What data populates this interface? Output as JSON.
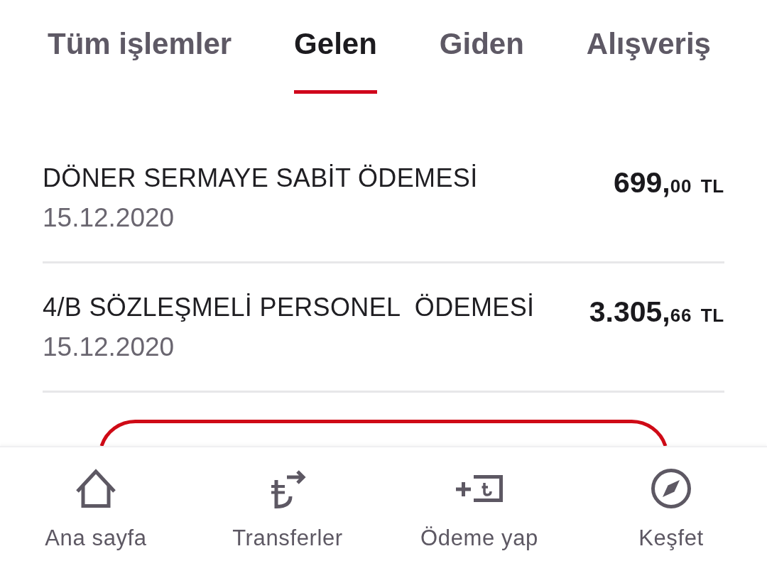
{
  "tabs": [
    {
      "label": "Tüm işlemler",
      "selected": false
    },
    {
      "label": "Gelen",
      "selected": true
    },
    {
      "label": "Giden",
      "selected": false
    },
    {
      "label": "Alışveriş",
      "selected": false
    }
  ],
  "transactions": [
    {
      "title": "DÖNER SERMAYE SABİT ÖDEMESİ",
      "date": "15.12.2020",
      "amount": {
        "whole": "699,",
        "fraction": "00",
        "currency": "TL"
      }
    },
    {
      "title": "4/B SÖZLEŞMELİ PERSONEL  ÖDEMESİ",
      "date": "15.12.2020",
      "amount": {
        "whole": "3.305,",
        "fraction": "66",
        "currency": "TL"
      }
    }
  ],
  "bottom_nav": [
    {
      "label": "Ana sayfa",
      "selected": false
    },
    {
      "label": "Transferler",
      "selected": false
    },
    {
      "label": "Ödeme yap",
      "selected": false
    },
    {
      "label": "Keşfet",
      "selected": false
    }
  ]
}
